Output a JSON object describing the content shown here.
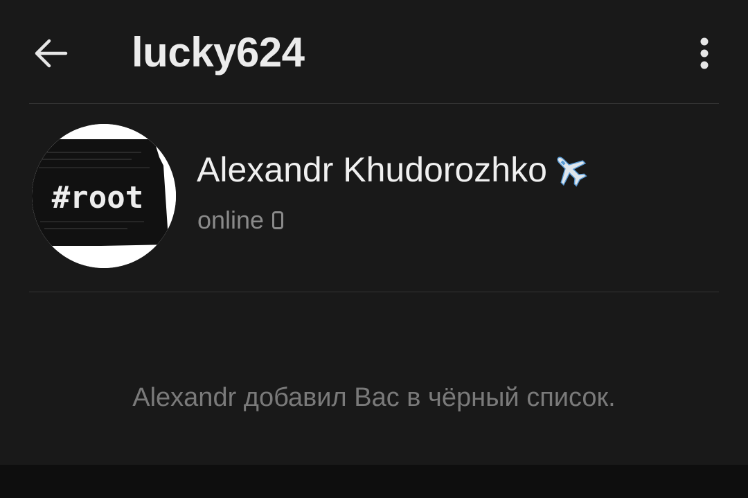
{
  "header": {
    "title": "lucky624",
    "back_icon": "arrow-left-icon",
    "menu_icon": "more-vertical-icon"
  },
  "profile": {
    "name": "Alexandr Khudorozhko",
    "name_emoji_icon": "airplane-icon",
    "status": "online",
    "status_icon": "mobile-phone-icon",
    "avatar_text": "#root"
  },
  "notice": {
    "text": "Alexandr добавил Вас в чёрный список."
  },
  "colors": {
    "background": "#191919",
    "primary_text": "#f0f0f0",
    "secondary_text": "#8a8a8a",
    "notice_text": "#7a7a7a",
    "divider": "#343434"
  }
}
